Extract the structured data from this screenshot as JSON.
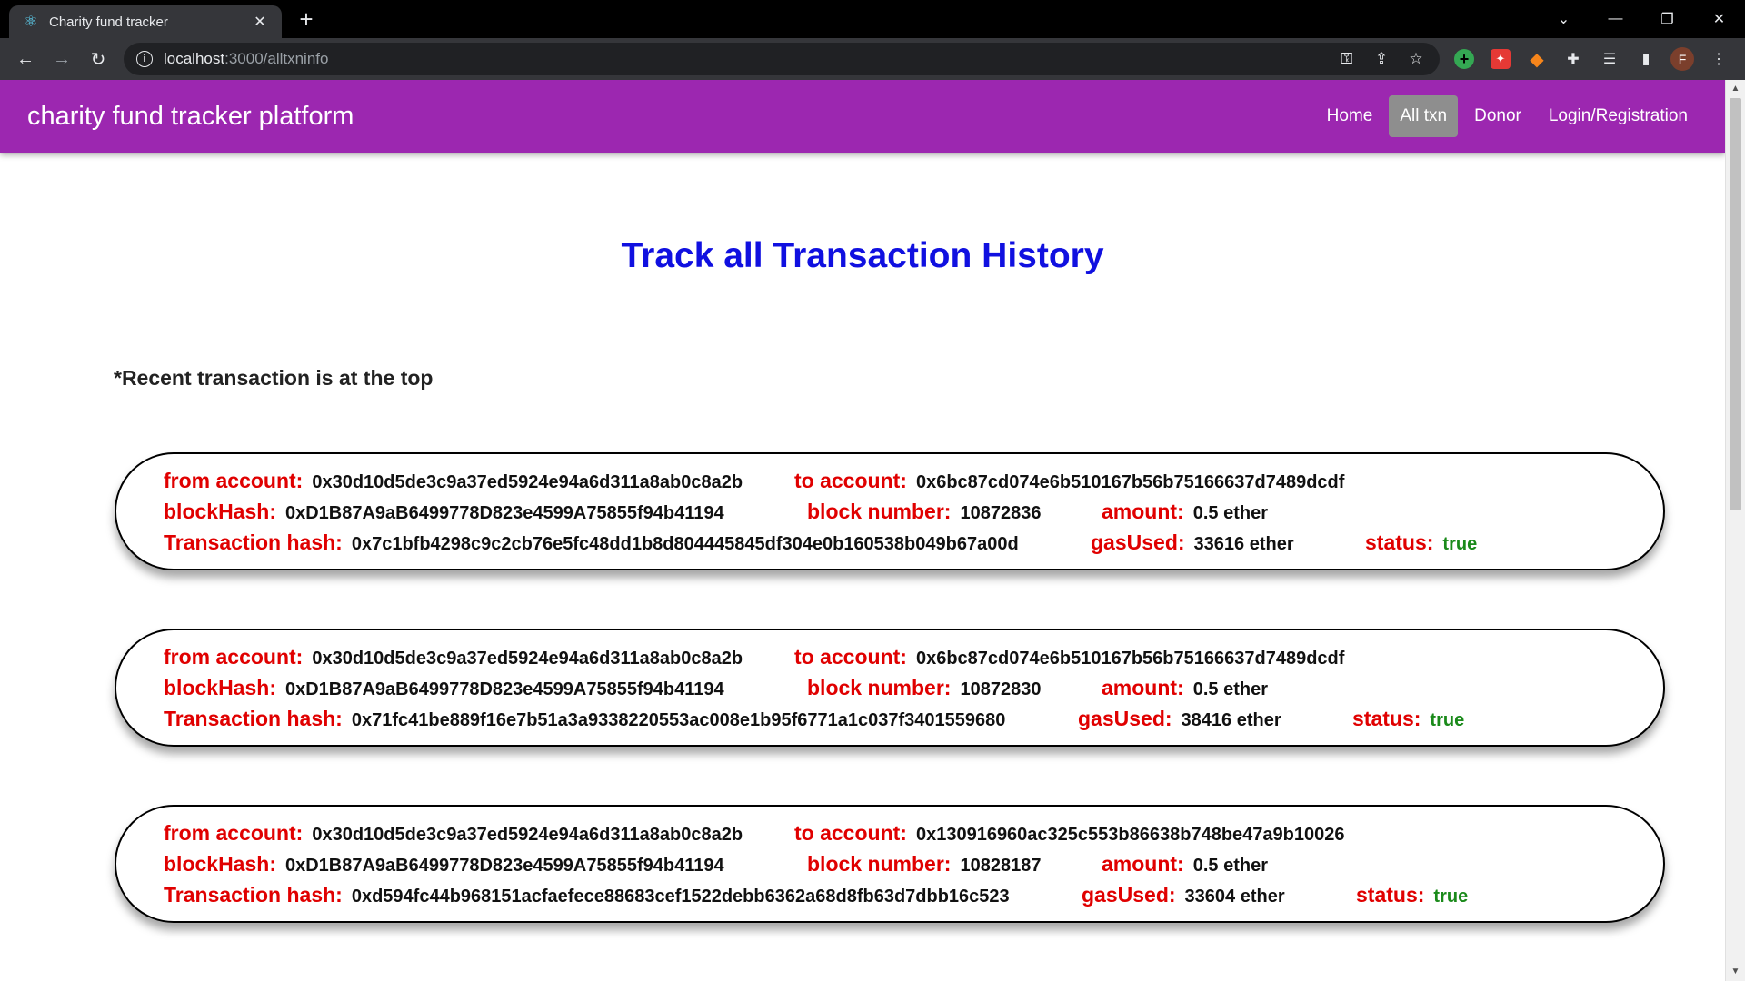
{
  "browser": {
    "tab_title": "Charity fund tracker",
    "url_host": "localhost",
    "url_path": ":3000/alltxninfo",
    "avatar_letter": "F"
  },
  "nav": {
    "brand": "charity fund tracker platform",
    "links": [
      "Home",
      "All txn",
      "Donor",
      "Login/Registration"
    ],
    "active": "All txn"
  },
  "page": {
    "heading": "Track all Transaction History",
    "note": "*Recent transaction is at the top"
  },
  "labels": {
    "from": "from account:",
    "to": "to account:",
    "block_hash": "blockHash:",
    "block_number": "block number:",
    "amount": "amount:",
    "tx_hash": "Transaction hash:",
    "gas_used": "gasUsed:",
    "status": "status:"
  },
  "transactions": [
    {
      "from": "0x30d10d5de3c9a37ed5924e94a6d311a8ab0c8a2b",
      "to": "0x6bc87cd074e6b510167b56b75166637d7489dcdf",
      "block_hash": "0xD1B87A9aB6499778D823e4599A75855f94b41194",
      "block_number": "10872836",
      "amount": "0.5 ether",
      "tx_hash": "0x7c1bfb4298c9c2cb76e5fc48dd1b8d804445845df304e0b160538b049b67a00d",
      "gas_used": "33616 ether",
      "status": "true"
    },
    {
      "from": "0x30d10d5de3c9a37ed5924e94a6d311a8ab0c8a2b",
      "to": "0x6bc87cd074e6b510167b56b75166637d7489dcdf",
      "block_hash": "0xD1B87A9aB6499778D823e4599A75855f94b41194",
      "block_number": "10872830",
      "amount": "0.5 ether",
      "tx_hash": "0x71fc41be889f16e7b51a3a9338220553ac008e1b95f6771a1c037f3401559680",
      "gas_used": "38416 ether",
      "status": "true"
    },
    {
      "from": "0x30d10d5de3c9a37ed5924e94a6d311a8ab0c8a2b",
      "to": "0x130916960ac325c553b86638b748be47a9b10026",
      "block_hash": "0xD1B87A9aB6499778D823e4599A75855f94b41194",
      "block_number": "10828187",
      "amount": "0.5 ether",
      "tx_hash": "0xd594fc44b968151acfaefece88683cef1522debb6362a68d8fb63d7dbb16c523",
      "gas_used": "33604 ether",
      "status": "true"
    }
  ]
}
